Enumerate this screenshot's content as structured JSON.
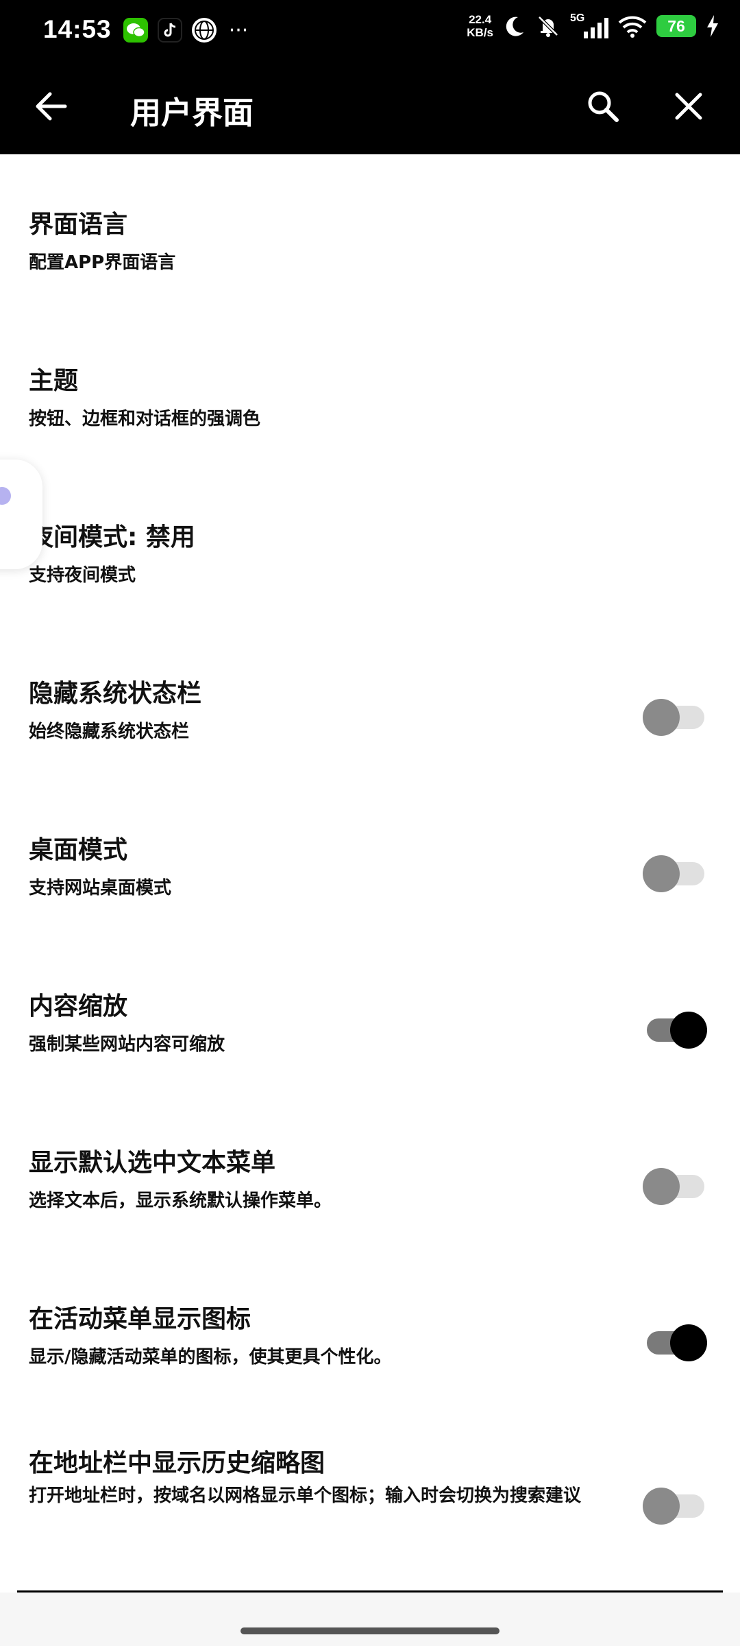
{
  "status_bar": {
    "time": "14:53",
    "speed_value": "22.4",
    "speed_unit": "KB/s",
    "network": "5G",
    "battery": "76",
    "more_label": "···"
  },
  "app_bar": {
    "title": "用户界面"
  },
  "settings": [
    {
      "title": "界面语言",
      "subtitle": "配置APP界面语言"
    },
    {
      "title": "主题",
      "subtitle": "按钮、边框和对话框的强调色"
    },
    {
      "title": "夜间模式: 禁用",
      "subtitle": "支持夜间模式"
    },
    {
      "title": "隐藏系统状态栏",
      "subtitle": "始终隐藏系统状态栏",
      "toggle": false
    },
    {
      "title": "桌面模式",
      "subtitle": "支持网站桌面模式",
      "toggle": false
    },
    {
      "title": "内容缩放",
      "subtitle": "强制某些网站内容可缩放",
      "toggle": true
    },
    {
      "title": "显示默认选中文本菜单",
      "subtitle": "选择文本后，显示系统默认操作菜单。",
      "toggle": false
    },
    {
      "title": "在活动菜单显示图标",
      "subtitle": "显示/隐藏活动菜单的图标，使其更具个性化。",
      "toggle": true
    },
    {
      "title": "在地址栏中显示历史缩略图",
      "subtitle": "打开地址栏时，按域名以网格显示单个图标；输入时会切换为搜索建议",
      "toggle": false
    }
  ]
}
